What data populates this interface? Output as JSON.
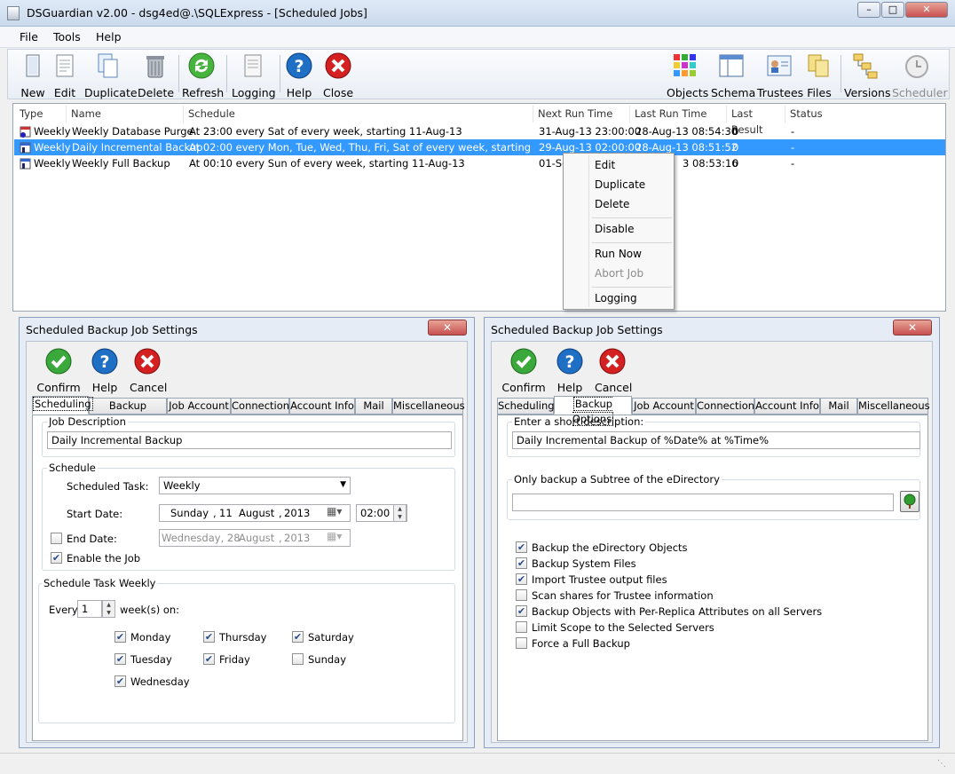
{
  "window": {
    "title": "DSGuardian v2.00 - dsg4ed@.\\SQLExpress - [Scheduled Jobs]"
  },
  "menu": [
    "File",
    "Tools",
    "Help"
  ],
  "toolbar": {
    "new": "New",
    "edit": "Edit",
    "duplicate": "Duplicate",
    "delete": "Delete",
    "refresh": "Refresh",
    "logging": "Logging",
    "help": "Help",
    "close": "Close",
    "objects": "Objects",
    "schema": "Schema",
    "trustees": "Trustees",
    "files": "Files",
    "versions": "Versions",
    "scheduler": "Scheduler"
  },
  "jobs": {
    "columns": [
      "Type",
      "Name",
      "Schedule",
      "Next Run Time",
      "Last Run Time",
      "Last Result",
      "Status"
    ],
    "rows": [
      {
        "type": "Weekly",
        "name": "Weekly Database Purge",
        "schedule": "At 23:00 every Sat of every week, starting 11-Aug-13",
        "next": "31-Aug-13 23:00:00",
        "last": "28-Aug-13 08:54:30",
        "result": "0",
        "status": "-"
      },
      {
        "type": "Weekly",
        "name": "Daily Incremental Backup",
        "schedule": "At 02:00 every Mon, Tue, Wed, Thu, Fri, Sat of every week, starting 11-Aug-13",
        "next": "29-Aug-13 02:00:00",
        "last": "28-Aug-13 08:51:52",
        "result": "0",
        "status": "-"
      },
      {
        "type": "Weekly",
        "name": "Weekly Full Backup",
        "schedule": "At 00:10 every Sun of every week, starting 11-Aug-13",
        "next": "01-Se",
        "last": "3 08:53:16",
        "result": "0",
        "status": "-"
      }
    ]
  },
  "context_menu": {
    "edit": "Edit",
    "duplicate": "Duplicate",
    "delete": "Delete",
    "disable": "Disable",
    "run_now": "Run Now",
    "abort_job": "Abort Job",
    "logging": "Logging"
  },
  "left_panel": {
    "title": "Scheduled Backup Job Settings",
    "confirm": "Confirm",
    "help": "Help",
    "cancel": "Cancel",
    "tabs": [
      "Scheduling",
      "Backup Options",
      "Job Account",
      "Connection",
      "Account Info",
      "Mail",
      "Miscellaneous"
    ],
    "job_description_label": "Job Description",
    "job_description": "Daily Incremental Backup",
    "schedule_label": "Schedule",
    "scheduled_task_label": "Scheduled Task:",
    "scheduled_task": "Weekly",
    "start_date_label": "Start Date:",
    "start_date": {
      "day": "Sunday",
      "d": "11",
      "month": "August",
      "year": "2013"
    },
    "start_time": "02:00",
    "end_date_label": "End Date:",
    "end_date": {
      "day": "Wednesday, 28",
      "month": "August",
      "year": "2013"
    },
    "enable_label": "Enable the Job",
    "weekly_label": "Schedule Task Weekly",
    "every_label": "Every",
    "every_value": "1",
    "weeks_on_label": "week(s) on:",
    "days": {
      "monday": "Monday",
      "tuesday": "Tuesday",
      "wednesday": "Wednesday",
      "thursday": "Thursday",
      "friday": "Friday",
      "saturday": "Saturday",
      "sunday": "Sunday"
    }
  },
  "right_panel": {
    "title": "Scheduled Backup Job Settings",
    "confirm": "Confirm",
    "help": "Help",
    "cancel": "Cancel",
    "tabs": [
      "Scheduling",
      "Backup Options",
      "Job Account",
      "Connection",
      "Account Info",
      "Mail",
      "Miscellaneous"
    ],
    "short_desc_label": "Enter a short description:",
    "short_desc": "Daily Incremental Backup of %Date% at %Time%",
    "subtree_label": "Only backup a Subtree of the eDirectory",
    "subtree_value": "",
    "options": [
      {
        "label": "Backup the eDirectory Objects",
        "checked": true
      },
      {
        "label": "Backup System Files",
        "checked": true
      },
      {
        "label": "Import Trustee output files",
        "checked": true
      },
      {
        "label": "Scan shares for Trustee information",
        "checked": false
      },
      {
        "label": "Backup Objects with Per-Replica Attributes on all Servers",
        "checked": true
      },
      {
        "label": "Limit Scope to the Selected Servers",
        "checked": false
      },
      {
        "label": "Force a Full Backup",
        "checked": false
      }
    ]
  },
  "colors": {
    "selection": "#3399ff",
    "help_blue": "#1f6fc5",
    "confirm_green": "#3aa83a",
    "cancel_red": "#d42020"
  }
}
